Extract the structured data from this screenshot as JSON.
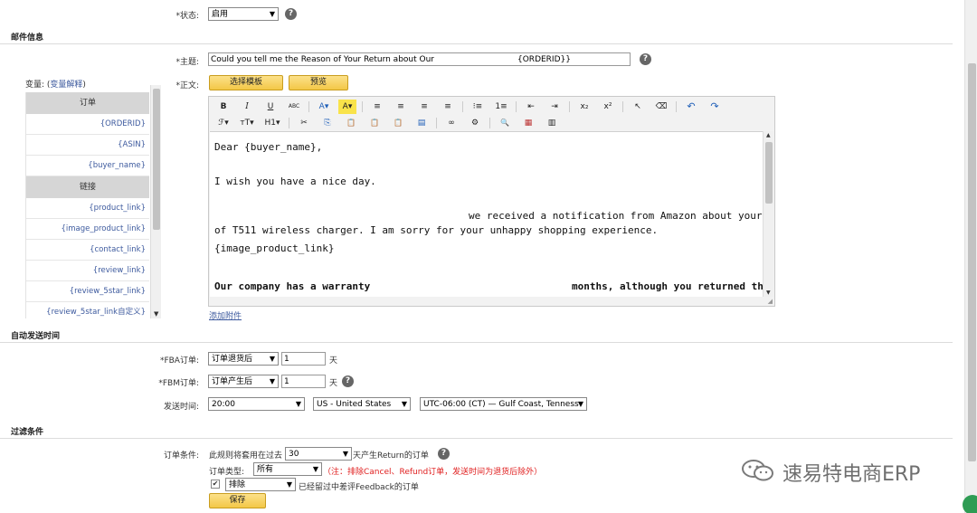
{
  "status": {
    "label": "*状态:",
    "value": "启用"
  },
  "mail_section": {
    "title": "邮件信息"
  },
  "subject": {
    "label": "*主题:",
    "value_left": "Could you tell me the Reason of Your Return about Our",
    "value_right": "{ORDERID}}"
  },
  "body": {
    "label": "*正文:",
    "template_button": "选择模板",
    "preview_button": "预览"
  },
  "variables": {
    "prefix": "变量: (",
    "explain_link": "变量解释",
    "suffix": ")",
    "order_group": "订单",
    "order_items": [
      "{ORDERID}",
      "{ASIN}",
      "{buyer_name}"
    ],
    "link_group": "链接",
    "link_items": [
      "{product_link}",
      "{image_product_link}",
      "{contact_link}",
      "{review_link}",
      "{review_5star_link}",
      "{review_5star_link自定义}"
    ]
  },
  "toolbar": {
    "row1": [
      "B",
      "I",
      "U",
      "ABC",
      "A▾",
      "A▾",
      "≡",
      "≡",
      "≡",
      "≡",
      "⁝≡",
      "1≡",
      "⇤",
      "⇥",
      "x₂",
      "x²",
      "↖",
      "⌫",
      "↶",
      "↷"
    ],
    "row2": [
      "ℱ▾",
      "тT▾",
      "H1▾",
      "✂",
      "⎘",
      "📋",
      "📋",
      "📋",
      "▤",
      "∞",
      "⚙",
      "🔍",
      "▦",
      "▥"
    ]
  },
  "editor_lines": [
    "Dear {buyer_name},",
    "I wish you have a nice day.",
    "we received a notification from Amazon about your return",
    "of T511 wireless charger. I am sorry for your unhappy shopping experience.",
    "{image_product_link}",
    "Our company has a warranty",
    "months, although you returned the charger, for any quality"
  ],
  "attach_link": "添加附件",
  "auto_section": {
    "title": "自动发送时间"
  },
  "fba": {
    "label": "*FBA订单:",
    "select": "订单退货后",
    "value": "1",
    "unit": "天"
  },
  "fbm": {
    "label": "*FBM订单:",
    "select": "订单产生后",
    "value": "1",
    "unit": "天"
  },
  "send_time": {
    "label": "发送时间:",
    "time": "20:00",
    "region": "US - United States",
    "timezone": "UTC-06:00 (CT) — Gulf Coast, Tenness"
  },
  "filter_section": {
    "title": "过滤条件"
  },
  "order_condition": {
    "label": "订单条件:",
    "prefix": "此规则将套用在过去",
    "days": "30",
    "suffix": "天产生Return的订单",
    "type_label": "订单类型:",
    "type_value": "所有",
    "note": "（注：排除Cancel、Refund订单，发送时间为退货后除外）",
    "exclude_value": "排除",
    "feedback_text": "已经留过中差评Feedback的订单"
  },
  "save_button": "保存",
  "watermark": "速易特电商ERP",
  "colors": {
    "accent_yellow": "#f3c747",
    "link_blue": "#3d5a9e",
    "note_red": "#e02020"
  }
}
